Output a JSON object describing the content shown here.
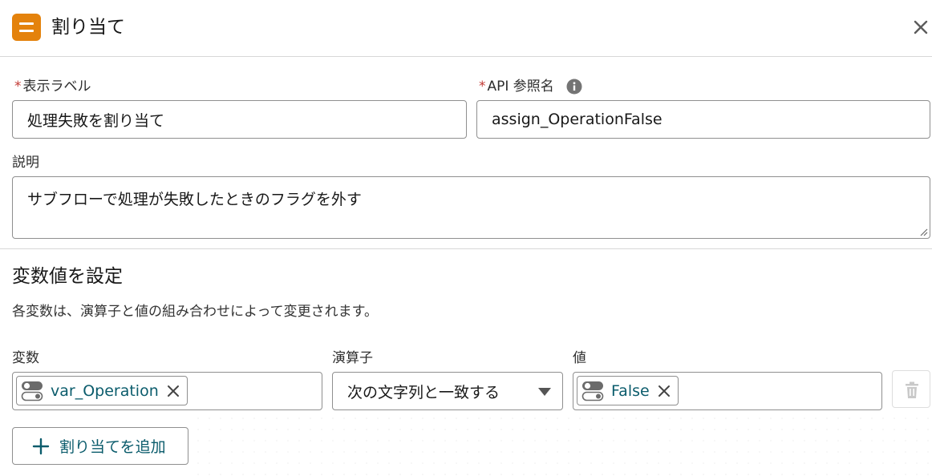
{
  "header": {
    "title": "割り当て"
  },
  "fields": {
    "required_mark": "*",
    "label_label": "表示ラベル",
    "label_value": "処理失敗を割り当て",
    "api_label": "API 参照名",
    "api_value": "assign_OperationFalse",
    "desc_label": "説明",
    "desc_value": "サブフローで処理が失敗したときのフラグを外す"
  },
  "section": {
    "title": "変数値を設定",
    "description": "各変数は、演算子と値の組み合わせによって変更されます。"
  },
  "assignment": {
    "variable_header": "変数",
    "operator_header": "演算子",
    "value_header": "値",
    "variable": "var_Operation",
    "operator": "次の文字列と一致する",
    "value": "False"
  },
  "add_button_label": "割り当てを追加",
  "colors": {
    "header_icon": "#e4820c",
    "pill_text": "#0b5c6c",
    "required": "#c23934"
  },
  "icons": {
    "header": "assignment-icon",
    "close": "close-icon",
    "info": "info-icon",
    "resource": "toggle-resource-icon",
    "remove": "close-icon",
    "dropdown": "caret-down-icon",
    "delete": "trash-icon",
    "add": "plus-icon"
  }
}
